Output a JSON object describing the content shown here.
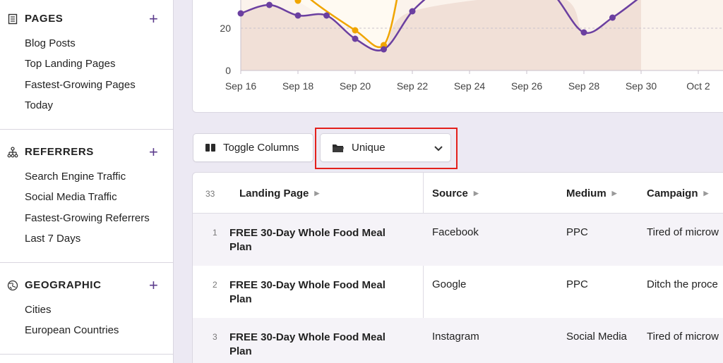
{
  "sidebar": {
    "pages": {
      "title": "PAGES",
      "add": "+",
      "items": [
        "Blog Posts",
        "Top Landing Pages",
        "Fastest-Growing Pages",
        "Today"
      ]
    },
    "referrers": {
      "title": "REFERRERS",
      "add": "+",
      "items": [
        "Search Engine Traffic",
        "Social Media Traffic",
        "Fastest-Growing Referrers",
        "Last 7 Days"
      ]
    },
    "geographic": {
      "title": "GEOGRAPHIC",
      "add": "+",
      "items": [
        "Cities",
        "European Countries"
      ]
    }
  },
  "chart_data": {
    "type": "area",
    "title": "",
    "xlabel": "",
    "ylabel": "",
    "x_ticks": [
      "Sep 16",
      "Sep 18",
      "Sep 20",
      "Sep 22",
      "Sep 24",
      "Sep 26",
      "Sep 28",
      "Sep 30",
      "Oct 2"
    ],
    "y_ticks": [
      "0",
      "20"
    ],
    "ylim": [
      0,
      36
    ],
    "series": [
      {
        "color": "#6b3fa0",
        "points": [
          [
            "Sep 16",
            27
          ],
          [
            "Sep 17",
            31
          ],
          [
            "Sep 18",
            26
          ],
          [
            "Sep 19",
            26
          ],
          [
            "Sep 20",
            15
          ],
          [
            "Sep 21",
            10
          ],
          [
            "Sep 22",
            28
          ],
          [
            "Sep 27",
            35
          ],
          [
            "Sep 28",
            18
          ],
          [
            "Sep 29",
            25
          ],
          [
            "Sep 30",
            35
          ]
        ]
      },
      {
        "color": "#f0a500",
        "points": [
          [
            "Sep 18",
            33
          ],
          [
            "Sep 20",
            19
          ],
          [
            "Sep 21",
            12
          ]
        ]
      }
    ],
    "grid": true
  },
  "toolbar": {
    "toggle_label": "Toggle Columns",
    "toggle_icon": "columns-icon",
    "view_label": "Unique",
    "view_icon": "folder-icon"
  },
  "table": {
    "count": "33",
    "headers": [
      "Landing Page",
      "Source",
      "Medium",
      "Campaign"
    ],
    "rows": [
      {
        "num": "1",
        "page": "FREE 30-Day Whole Food Meal Plan",
        "source": "Facebook",
        "medium": "PPC",
        "campaign": "Tired of microw"
      },
      {
        "num": "2",
        "page": "FREE 30-Day Whole Food Meal Plan",
        "source": "Google",
        "medium": "PPC",
        "campaign": "Ditch the proce"
      },
      {
        "num": "3",
        "page": "FREE 30-Day Whole Food Meal Plan",
        "source": "Instagram",
        "medium": "Social Media",
        "campaign": "Tired of microw"
      }
    ]
  },
  "colors": {
    "accent": "#5b3b8c",
    "purple_line": "#6b3fa0",
    "orange_line": "#f0a500",
    "highlight": "#e3201b"
  }
}
